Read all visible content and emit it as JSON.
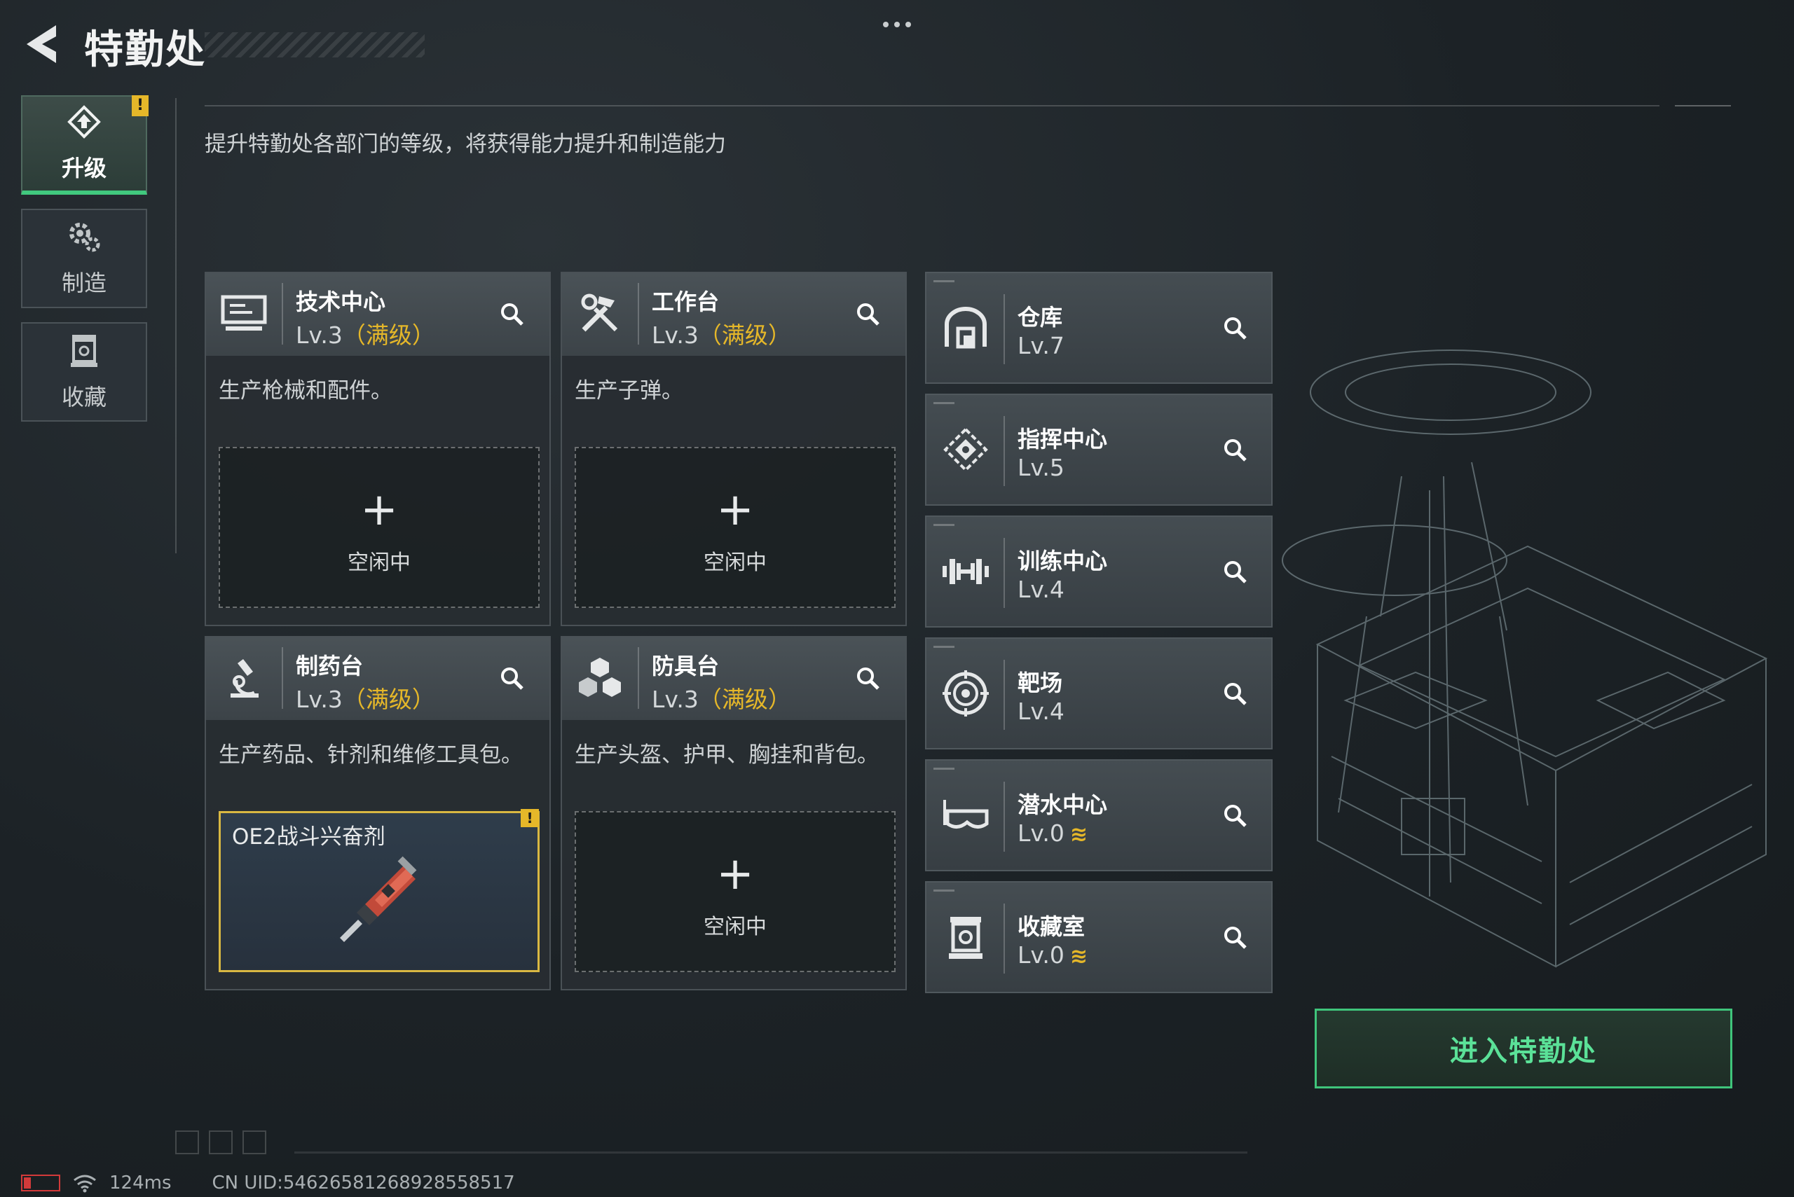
{
  "header": {
    "title": "特勤处"
  },
  "sidebar": {
    "tabs": [
      {
        "label": "升级",
        "icon": "upgrade-icon",
        "active": true,
        "warning": "!"
      },
      {
        "label": "制造",
        "icon": "gear-icon",
        "active": false
      },
      {
        "label": "收藏",
        "icon": "collection-icon",
        "active": false
      }
    ]
  },
  "main": {
    "description": "提升特勤处各部门的等级，将获得能力提升和制造能力",
    "departments": [
      {
        "name": "技术中心",
        "level": "Lv.3",
        "max_label": "（满级）",
        "icon": "monitor-icon",
        "desc": "生产枪械和配件。",
        "slot": {
          "plus": "+",
          "status": "空闲中"
        }
      },
      {
        "name": "工作台",
        "level": "Lv.3",
        "max_label": "（满级）",
        "icon": "hammer-wrench-icon",
        "desc": "生产子弹。",
        "slot": {
          "plus": "+",
          "status": "空闲中"
        }
      },
      {
        "name": "制药台",
        "level": "Lv.3",
        "max_label": "（满级）",
        "icon": "microscope-icon",
        "desc": "生产药品、针剂和维修工具包。",
        "slot": {
          "item": "OE2战斗兴奋剂",
          "warning": "!"
        }
      },
      {
        "name": "防具台",
        "level": "Lv.3",
        "max_label": "（满级）",
        "icon": "cubes-icon",
        "desc": "生产头盔、护甲、胸挂和背包。",
        "slot": {
          "plus": "+",
          "status": "空闲中"
        }
      }
    ],
    "facilities": [
      {
        "name": "仓库",
        "level": "Lv.7",
        "icon": "warehouse-icon",
        "upgradable": false
      },
      {
        "name": "指挥中心",
        "level": "Lv.5",
        "icon": "command-icon",
        "upgradable": false
      },
      {
        "name": "训练中心",
        "level": "Lv.4",
        "icon": "dumbbell-icon",
        "upgradable": false
      },
      {
        "name": "靶场",
        "level": "Lv.4",
        "icon": "target-icon",
        "upgradable": false
      },
      {
        "name": "潜水中心",
        "level": "Lv.0",
        "icon": "diving-mask-icon",
        "upgradable": true,
        "up_icon": "≋"
      },
      {
        "name": "收藏室",
        "level": "Lv.0",
        "icon": "collection-room-icon",
        "upgradable": true,
        "up_icon": "≋"
      }
    ],
    "enter_button": "进入特勤处"
  },
  "status": {
    "ping": "124ms",
    "uid": "CN UID:5462658126892855851​7"
  },
  "colors": {
    "accent_green": "#41c97e",
    "maxed_yellow": "#e5b729",
    "warning_yellow": "#e5b729",
    "battery_red": "#d33a3a"
  }
}
